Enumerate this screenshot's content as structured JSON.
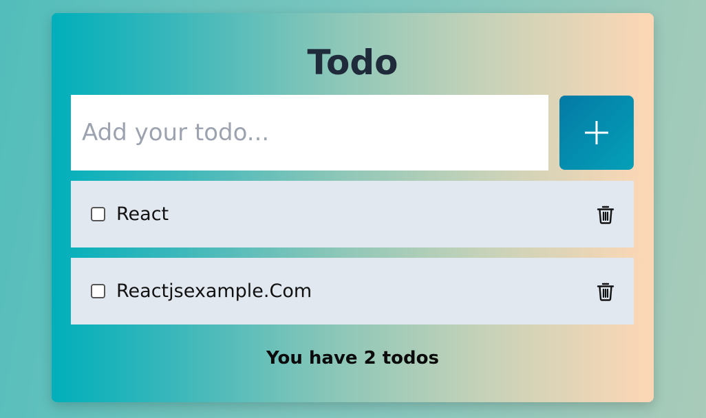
{
  "app": {
    "title": "Todo"
  },
  "input": {
    "value": "",
    "placeholder": "Add your todo...",
    "add_icon": "plus-icon"
  },
  "todos": [
    {
      "label": "React",
      "checked": false,
      "delete_icon": "trash-icon"
    },
    {
      "label": "Reactjsexample.Com",
      "checked": false,
      "delete_icon": "trash-icon"
    }
  ],
  "footer": {
    "text": "You have 2 todos"
  },
  "colors": {
    "title": "#1f2b3b",
    "item_background": "#e2e8f0",
    "add_button_start": "#047aa5",
    "add_button_end": "#04a0b8",
    "placeholder": "#9ca3af"
  }
}
